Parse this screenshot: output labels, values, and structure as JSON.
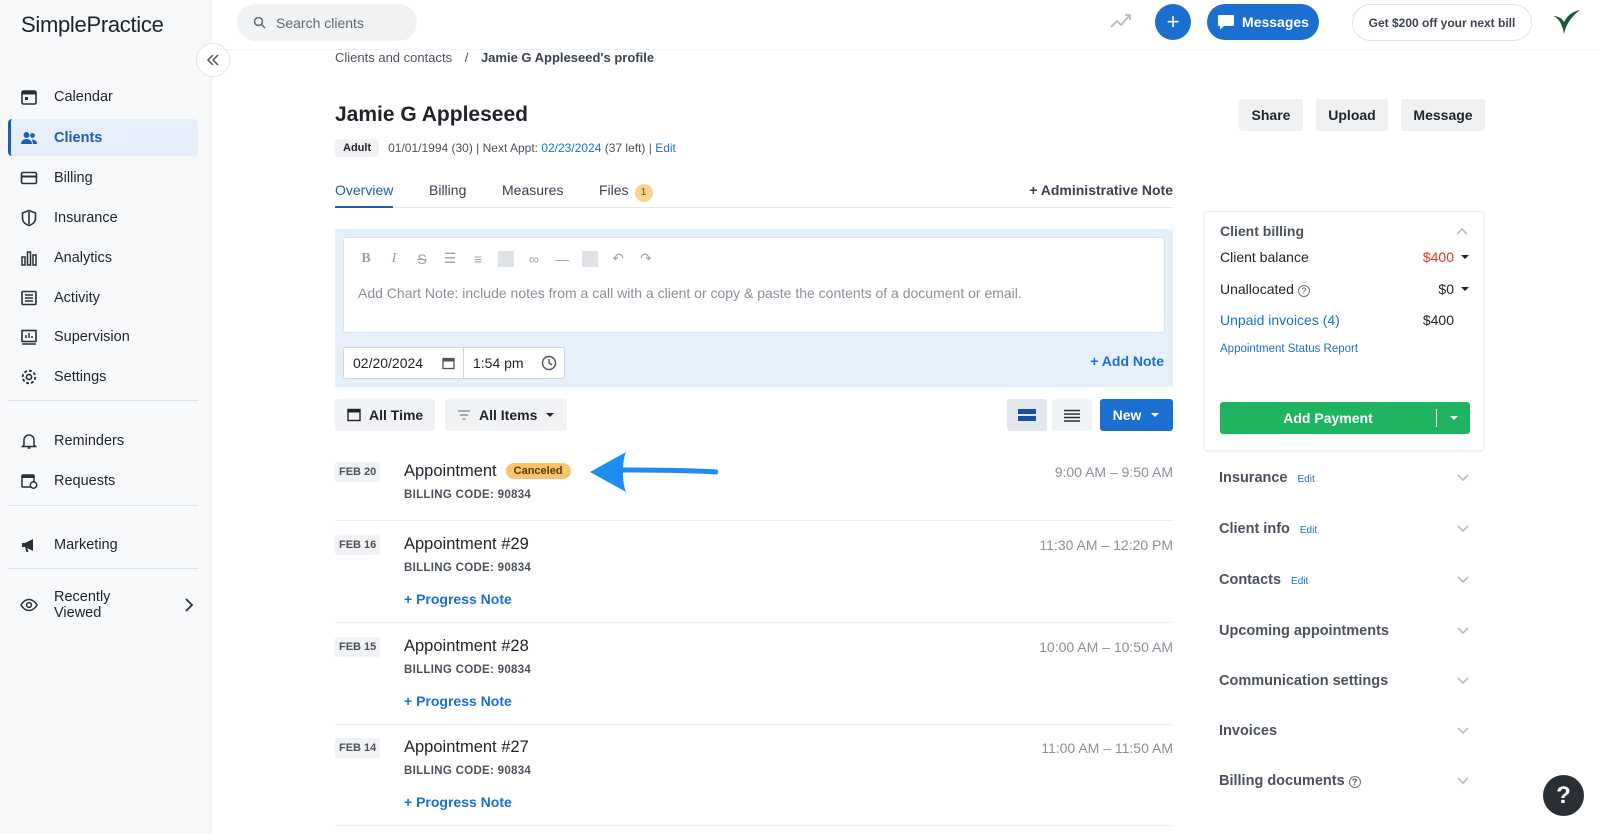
{
  "app": {
    "brand": "SimplePractice"
  },
  "sidebar": {
    "items": [
      {
        "label": "Calendar",
        "icon": "calendar-icon"
      },
      {
        "label": "Clients",
        "icon": "clients-icon"
      },
      {
        "label": "Billing",
        "icon": "billing-icon"
      },
      {
        "label": "Insurance",
        "icon": "shield-icon"
      },
      {
        "label": "Analytics",
        "icon": "analytics-icon"
      },
      {
        "label": "Activity",
        "icon": "activity-icon"
      },
      {
        "label": "Supervision",
        "icon": "supervision-icon"
      },
      {
        "label": "Settings",
        "icon": "gear-icon"
      },
      {
        "label": "Reminders",
        "icon": "bell-icon"
      },
      {
        "label": "Requests",
        "icon": "requests-icon"
      },
      {
        "label": "Marketing",
        "icon": "megaphone-icon"
      },
      {
        "label": "Recently Viewed",
        "icon": "eye-icon"
      }
    ]
  },
  "topbar": {
    "search_placeholder": "Search clients",
    "messages_label": "Messages",
    "promo": "Get $200 off your next bill"
  },
  "breadcrumb": {
    "parent": "Clients and contacts",
    "separator": "/",
    "current": "Jamie G Appleseed's profile"
  },
  "client": {
    "name": "Jamie G Appleseed",
    "tag": "Adult",
    "dob": "01/01/1994 (30) | Next Appt: ",
    "next_appt": "02/23/2024",
    "left": " (37 left) | ",
    "edit": "Edit"
  },
  "header_buttons": {
    "share": "Share",
    "upload": "Upload",
    "message": "Message"
  },
  "tabs": {
    "overview": "Overview",
    "billing": "Billing",
    "measures": "Measures",
    "files": "Files",
    "files_count": "1",
    "admin_note": "+ Administrative Note"
  },
  "note": {
    "placeholder": "Add Chart Note: include notes from a call with a client or copy & paste the contents of a document or email.",
    "date": "02/20/2024",
    "time": "1:54 pm",
    "add_note": "+ Add Note"
  },
  "filters": {
    "time": "All Time",
    "items": "All Items",
    "new": "New"
  },
  "appointments": [
    {
      "date": "FEB 20",
      "title": "Appointment",
      "status": "Canceled",
      "code": "BILLING CODE: 90834",
      "time": "9:00 AM – 9:50 AM"
    },
    {
      "date": "FEB 16",
      "title": "Appointment #29",
      "code": "BILLING CODE: 90834",
      "time": "11:30 AM – 12:20 PM",
      "note": "+ Progress Note"
    },
    {
      "date": "FEB 15",
      "title": "Appointment #28",
      "code": "BILLING CODE: 90834",
      "time": "10:00 AM – 10:50 AM",
      "note": "+ Progress Note"
    },
    {
      "date": "FEB 14",
      "title": "Appointment #27",
      "code": "BILLING CODE: 90834",
      "time": "11:00 AM – 11:50 AM",
      "note": "+ Progress Note"
    }
  ],
  "billing_panel": {
    "title": "Client billing",
    "balance_label": "Client balance",
    "balance_value": "$400",
    "unallocated_label": "Unallocated",
    "unallocated_value": "$0",
    "unpaid_label": "Unpaid invoices (4)",
    "unpaid_value": "$400",
    "report_link": "Appointment Status Report",
    "add_payment": "Add Payment"
  },
  "sections": [
    {
      "label": "Insurance",
      "edit": "Edit"
    },
    {
      "label": "Client info",
      "edit": "Edit"
    },
    {
      "label": "Contacts",
      "edit": "Edit"
    },
    {
      "label": "Upcoming appointments"
    },
    {
      "label": "Communication settings"
    },
    {
      "label": "Invoices"
    },
    {
      "label": "Billing documents"
    }
  ],
  "colors": {
    "accent": "#1a6fd1",
    "balance_red": "#e0341c",
    "pay_green": "#1fb55e",
    "canceled_badge": "#f8c470"
  }
}
